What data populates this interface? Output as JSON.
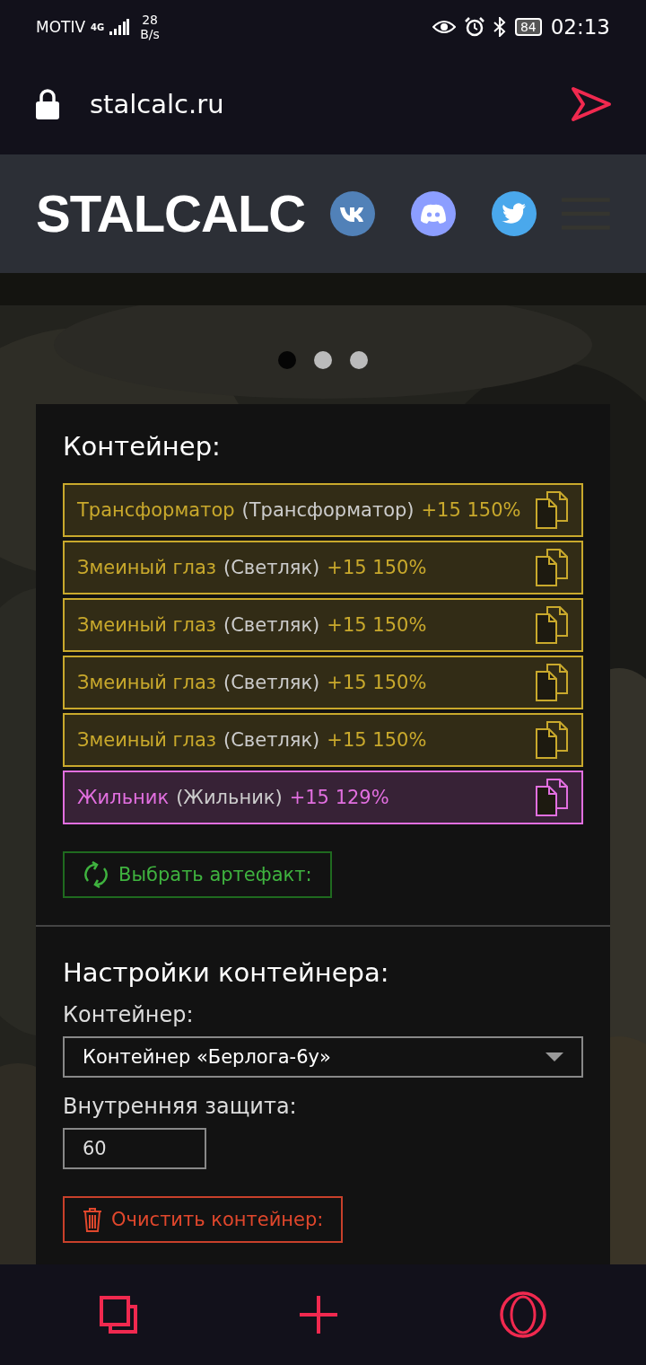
{
  "status_bar": {
    "carrier": "MOTIV",
    "network": "4G",
    "speed": "28",
    "speed_unit": "B/s",
    "battery": "84",
    "time": "02:13"
  },
  "address_bar": {
    "url": "stalcalc.ru"
  },
  "site_header": {
    "logo": "STALCALC"
  },
  "carousel": {
    "dots": [
      {
        "selected": true
      },
      {
        "selected": false
      },
      {
        "selected": false
      }
    ]
  },
  "container_panel": {
    "title": "Контейнер:",
    "artifacts": [
      {
        "name": "Трансформатор",
        "original": "(Трансформатор)",
        "bonus": "+15 150%",
        "color": "#c9a92c"
      },
      {
        "name": "Змеиный глаз",
        "original": "(Светляк)",
        "bonus": "+15 150%",
        "color": "#c9a92c"
      },
      {
        "name": "Змеиный глаз",
        "original": "(Светляк)",
        "bonus": "+15 150%",
        "color": "#c9a92c"
      },
      {
        "name": "Змеиный глаз",
        "original": "(Светляк)",
        "bonus": "+15 150%",
        "color": "#c9a92c"
      },
      {
        "name": "Змеиный глаз",
        "original": "(Светляк)",
        "bonus": "+15 150%",
        "color": "#c9a92c"
      },
      {
        "name": "Жильник",
        "original": "(Жильник)",
        "bonus": "+15 129%",
        "color": "#e26fe0"
      }
    ],
    "select_button": "Выбрать артефакт:"
  },
  "settings": {
    "title": "Настройки контейнера:",
    "container_label": "Контейнер:",
    "container_value": "Контейнер «Берлога-6у»",
    "protection_label": "Внутренняя защита:",
    "protection_value": "60",
    "clear_button": "Очистить контейнер:"
  }
}
